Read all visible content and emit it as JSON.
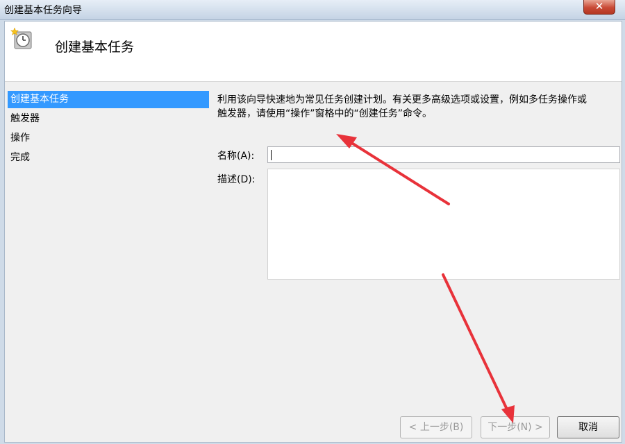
{
  "window": {
    "title": "创建基本任务向导",
    "close_glyph": "✕"
  },
  "header": {
    "title": "创建基本任务",
    "icon": "clock-icon"
  },
  "sidebar": {
    "items": [
      {
        "label": "创建基本任务",
        "active": true
      },
      {
        "label": "触发器",
        "active": false
      },
      {
        "label": "操作",
        "active": false
      },
      {
        "label": "完成",
        "active": false
      }
    ]
  },
  "main": {
    "description_line1": "利用该向导快速地为常见任务创建计划。有关更多高级选项或设置，例如多任务操作或",
    "description_line2": "触发器，请使用“操作”窗格中的“创建任务”命令。",
    "name_label": "名称(A):",
    "name_value": "",
    "desc_label": "描述(D):",
    "desc_value": ""
  },
  "buttons": {
    "back": "< 上一步(B)",
    "next": "下一步(N) >",
    "cancel": "取消"
  },
  "colors": {
    "selection": "#3399ff",
    "annotation_arrow": "#e8323a"
  }
}
